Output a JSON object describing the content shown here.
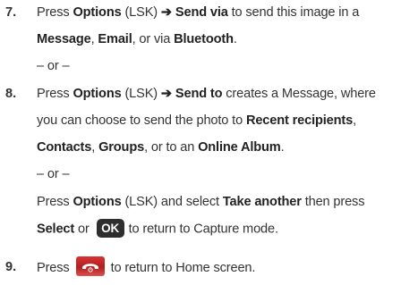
{
  "step7": {
    "num": "7.",
    "l1_a": "Press ",
    "l1_options": "Options",
    "l1_b": " (LSK) ",
    "l1_arrow": "➔",
    "l1_sendvia": " Send via",
    "l1_c": " to send this image in a",
    "l2_message": "Message",
    "l2_a": ", ",
    "l2_email": "Email",
    "l2_b": ", or via ",
    "l2_bluetooth": "Bluetooth",
    "l2_c": ".",
    "or": "– or –"
  },
  "step8": {
    "num": "8.",
    "l1_a": "Press ",
    "l1_options": "Options",
    "l1_b": " (LSK) ",
    "l1_arrow": "➔",
    "l1_sendto": " Send to",
    "l1_c": " creates a Message, where",
    "l2_a": "you can choose to send the photo to ",
    "l2_recent": "Recent recipients",
    "l2_b": ",",
    "l3_contacts": "Contacts",
    "l3_a": ", ",
    "l3_groups": "Groups",
    "l3_b": ", or to an ",
    "l3_album": "Online Album",
    "l3_c": ".",
    "or": "– or –",
    "l5_a": "Press ",
    "l5_options": "Options",
    "l5_b": " (LSK) and select ",
    "l5_take": "Take another",
    "l5_c": " then press",
    "l6_select": "Select",
    "l6_a": " or ",
    "l6_ok": "OK",
    "l6_b": "to return to Capture mode."
  },
  "step9": {
    "num": "9.",
    "a": "Press",
    "icon": "end-call-key-icon",
    "b": "to return to Home screen."
  },
  "colors": {
    "text": "#333333",
    "ok_key": "#2e2e2e",
    "end_key": "#c62828"
  }
}
